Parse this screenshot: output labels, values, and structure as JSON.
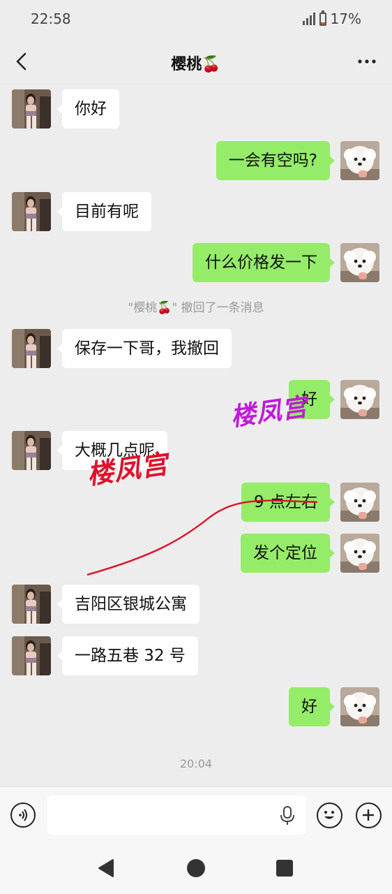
{
  "status_bar": {
    "time": "22:58",
    "battery_percent": "17%",
    "battery_level": 0.17
  },
  "header": {
    "title": "樱桃🍒",
    "back_icon": "chevron-left-icon",
    "more_icon": "more-dots-icon"
  },
  "messages": [
    {
      "side": "in",
      "text": "你好"
    },
    {
      "side": "out",
      "text": "一会有空吗?"
    },
    {
      "side": "in",
      "text": "目前有呢"
    },
    {
      "side": "out",
      "text": "什么价格发一下"
    },
    {
      "side": "system",
      "text": "\"樱桃🍒\" 撤回了一条消息"
    },
    {
      "side": "in",
      "text": "保存一下哥，我撤回"
    },
    {
      "side": "out",
      "text": "好"
    },
    {
      "side": "in",
      "text": "大概几点呢"
    },
    {
      "side": "out",
      "text": "9 点左右"
    },
    {
      "side": "out",
      "text": "发个定位"
    },
    {
      "side": "in",
      "text": "吉阳区银城公寓"
    },
    {
      "side": "in",
      "text": "一路五巷 32 号"
    },
    {
      "side": "out",
      "text": "好"
    }
  ],
  "timestamp": "20:04",
  "watermarks": [
    "楼凤宫",
    "楼凤宫"
  ],
  "input_bar": {
    "placeholder": "",
    "voice_icon": "voice-toggle-icon",
    "mic_icon": "microphone-icon",
    "emoji_icon": "emoji-icon",
    "plus_icon": "plus-icon"
  },
  "system_nav": {
    "back_icon": "triangle-back-icon",
    "home_icon": "circle-home-icon",
    "recents_icon": "square-recents-icon"
  },
  "colors": {
    "outgoing_bubble": "#95ec69",
    "incoming_bubble": "#ffffff",
    "background": "#ededed",
    "watermark_red": "#e0102a",
    "watermark_purple": "#c01ad8"
  }
}
